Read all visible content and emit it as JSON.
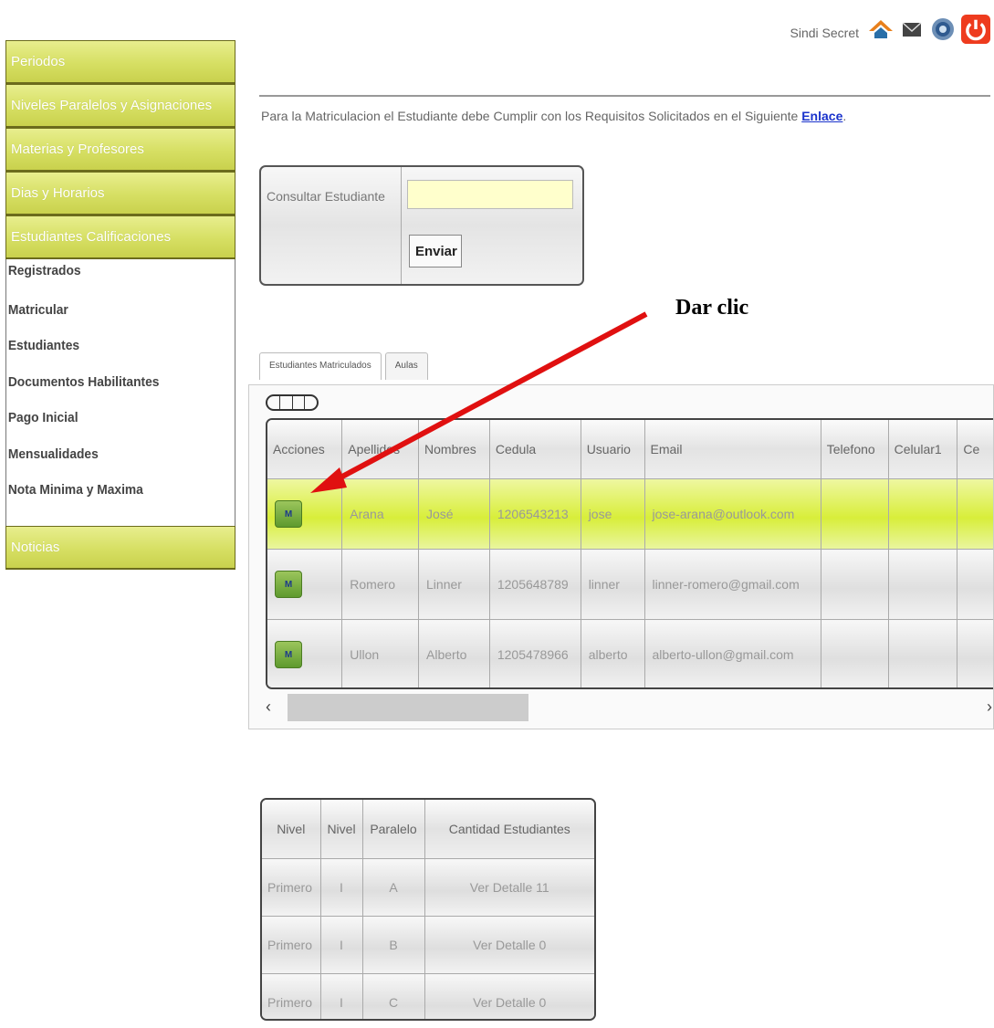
{
  "sidebar": {
    "menu": [
      "Periodos",
      "Niveles Paralelos y Asignaciones",
      "Materias y Profesores",
      "Dias y Horarios",
      "Estudiantes Calificaciones"
    ],
    "sub_items": [
      "Registrados",
      "Matricular",
      "Estudiantes",
      "Documentos Habilitantes",
      "Pago Inicial",
      "Mensualidades",
      "Nota Minima y Maxima"
    ],
    "bottom": "Noticias"
  },
  "header": {
    "user": "Sindi Secret",
    "icons": [
      "home-icon",
      "mail-icon",
      "settings-icon",
      "power-icon"
    ]
  },
  "notice": {
    "text": "Para la Matriculacion el Estudiante debe Cumplir con los Requisitos Solicitados en el Siguiente ",
    "link": "Enlace",
    "end": "."
  },
  "query": {
    "label": "Consultar Estudiante",
    "value": "",
    "button": "Enviar"
  },
  "annotation": "Dar clic",
  "tabs": [
    "Estudiantes Matriculados",
    "Aulas"
  ],
  "grid": {
    "columns": [
      "Acciones",
      "Apellidos",
      "Nombres",
      "Cedula",
      "Usuario",
      "Email",
      "Telefono",
      "Celular1",
      "Ce"
    ],
    "rows": [
      {
        "action": "M",
        "apellidos": "Arana",
        "nombres": "José",
        "cedula": "1206543213",
        "usuario": "jose",
        "email": "jose-arana@outlook.com",
        "telefono": "",
        "celular1": "",
        "ce": ""
      },
      {
        "action": "M",
        "apellidos": "Romero",
        "nombres": "Linner",
        "cedula": "1205648789",
        "usuario": "linner",
        "email": "linner-romero@gmail.com",
        "telefono": "",
        "celular1": "",
        "ce": ""
      },
      {
        "action": "M",
        "apellidos": "Ullon",
        "nombres": "Alberto",
        "cedula": "1205478966",
        "usuario": "alberto",
        "email": "alberto-ullon@gmail.com",
        "telefono": "",
        "celular1": "",
        "ce": ""
      }
    ],
    "scroll_left": "‹",
    "scroll_right": "›"
  },
  "summary": {
    "columns": [
      "Nivel",
      "Nivel",
      "Paralelo",
      "Cantidad Estudiantes"
    ],
    "rows": [
      [
        "Primero",
        "I",
        "A",
        "Ver Detalle 11"
      ],
      [
        "Primero",
        "I",
        "B",
        "Ver Detalle 0"
      ],
      [
        "Primero",
        "I",
        "C",
        "Ver Detalle 0"
      ]
    ]
  },
  "colors": {
    "menu": "#d6df63",
    "highlight": "#d8ee3a",
    "arrow": "#e01010",
    "link": "#1a33cc"
  }
}
